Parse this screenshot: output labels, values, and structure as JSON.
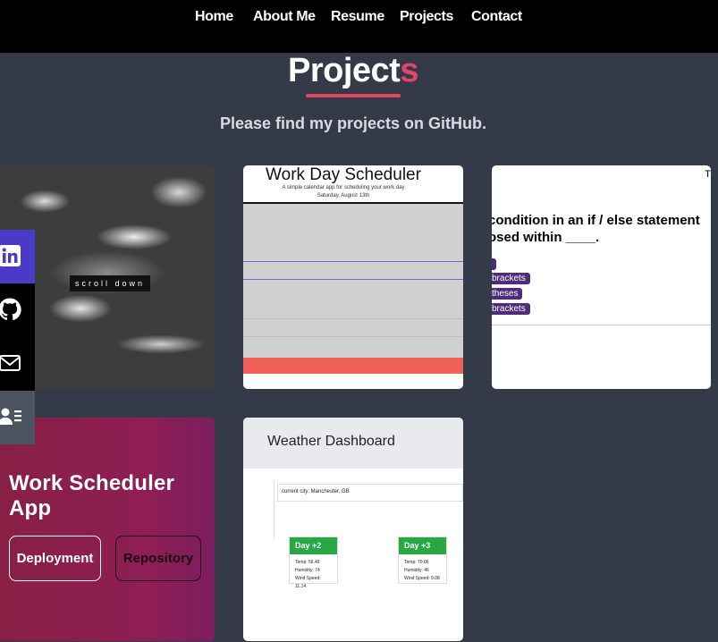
{
  "nav": {
    "links": [
      "Home",
      "About Me",
      "Resume",
      "Projects",
      "Contact"
    ]
  },
  "section": {
    "title_main": "Project",
    "title_accent": "s",
    "subtitle": "Please find my projects on GitHub."
  },
  "cards": {
    "cloud": {
      "tag": "scroll down"
    },
    "scheduler": {
      "title": "Work Day Scheduler",
      "subtitle": "A simple calendar app for scheduling your work day",
      "date": "Saturday, August 13th"
    },
    "quiz": {
      "corner": "T",
      "question_line1": "condition in an if / else statement",
      "question_line2": "osed within ____.",
      "options": [
        "",
        "brackets",
        "theses",
        "brackets"
      ]
    },
    "project": {
      "title": "Work Scheduler App",
      "deployment_label": "Deployment",
      "repository_label": "Repository"
    },
    "weather": {
      "title": "Weather Dashboard",
      "city": "current city: Manchester, GB",
      "days": [
        {
          "label": "Day +2",
          "temp": "Temp: 56.49",
          "humidity": "Humidity: 74",
          "wind": "Wind Speed: 11.14"
        },
        {
          "label": "Day +3",
          "temp": "Temp: 70.06",
          "humidity": "Humidity: 46",
          "wind": "Wind Speed: 9.08"
        }
      ]
    }
  },
  "social": [
    "linkedin-icon",
    "github-icon",
    "mail-icon",
    "contact-card-icon"
  ],
  "colors": {
    "accent": "#e7436a",
    "background": "#343a48",
    "social_active": "#4b39c8",
    "social_bg": "#000000",
    "social_last_bg": "#4b5460"
  }
}
